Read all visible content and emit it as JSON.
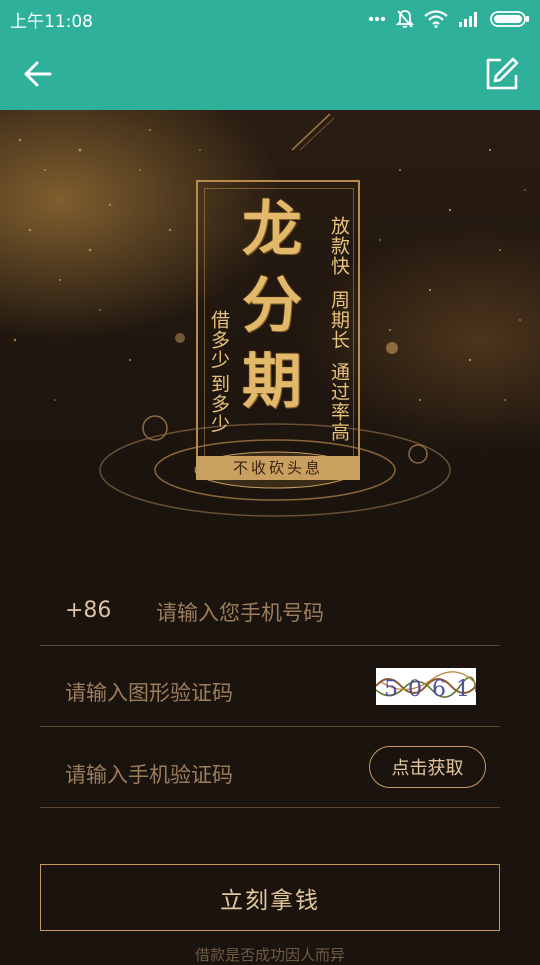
{
  "status_bar": {
    "time": "上午11:08",
    "icons": [
      "more-dots-icon",
      "mute-bell-icon",
      "wifi-icon",
      "signal-icon",
      "battery-icon"
    ]
  },
  "toolbar": {
    "back_icon": "arrow-left-icon",
    "edit_icon": "edit-square-icon",
    "background_color": "#2eb09a"
  },
  "banner": {
    "title_chars": [
      "龙",
      "分",
      "期"
    ],
    "right_lines": [
      "放款快",
      "周期长",
      "通过率高"
    ],
    "left_lines": [
      "借多少",
      "到多少"
    ],
    "ribbon": "不收砍头息"
  },
  "form": {
    "country_code": "+86",
    "phone_placeholder": "请输入您手机号码",
    "captcha_placeholder": "请输入图形验证码",
    "captcha_text": "5061",
    "sms_placeholder": "请输入手机验证码",
    "get_code_label": "点击获取",
    "submit_label": "立刻拿钱"
  },
  "footer": {
    "note": "借款是否成功因人而异"
  },
  "colors": {
    "accent_teal": "#2eb09a",
    "gold": "#c79a5e",
    "background": "#1a130e"
  }
}
